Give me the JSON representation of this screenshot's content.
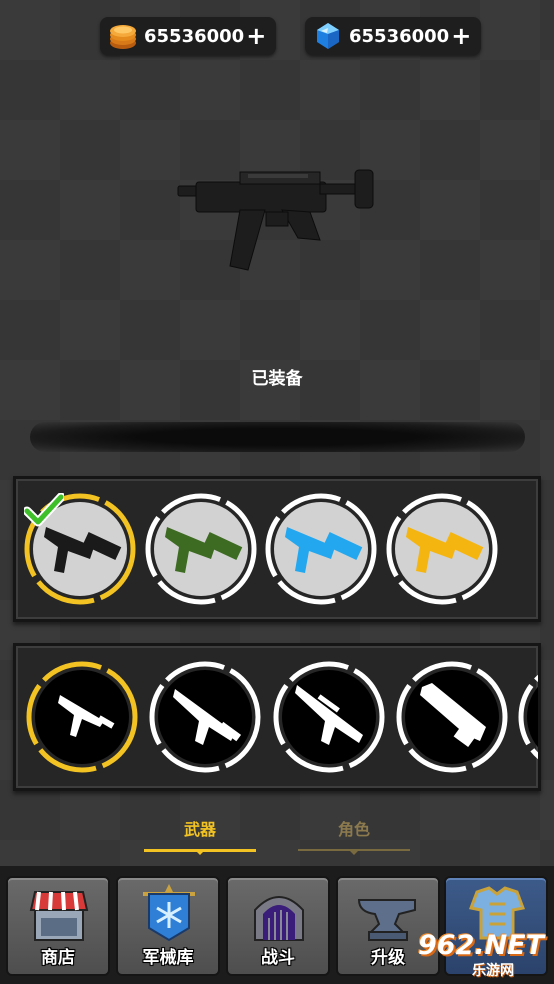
{
  "currency": {
    "coins": {
      "amount": "65536000",
      "plus": "+",
      "icon": "gold-coin-stack-icon",
      "color": "#e58a1c"
    },
    "gems": {
      "amount": "65536000",
      "plus": "+",
      "icon": "blue-gem-icon",
      "color": "#2fa0ff"
    }
  },
  "preview": {
    "status": "已装备",
    "weapon": "black-smg"
  },
  "skins": [
    {
      "name": "black",
      "color": "#1a1a1a",
      "selected": true,
      "equipped": true
    },
    {
      "name": "green",
      "color": "#3d6b22",
      "selected": false,
      "equipped": false
    },
    {
      "name": "blue",
      "color": "#23a8f0",
      "selected": false,
      "equipped": false
    },
    {
      "name": "yellow",
      "color": "#f5b511",
      "selected": false,
      "equipped": false
    }
  ],
  "weapons": [
    {
      "name": "smg",
      "selected": true
    },
    {
      "name": "assault-rifle",
      "selected": false
    },
    {
      "name": "rifle-scoped",
      "selected": false
    },
    {
      "name": "minigun",
      "selected": false
    },
    {
      "name": "locked-weapon",
      "selected": false
    }
  ],
  "tabs": {
    "weapons": "武器",
    "characters": "角色"
  },
  "nav": [
    {
      "label": "商店",
      "icon": "shop-icon"
    },
    {
      "label": "军械库",
      "icon": "armory-icon"
    },
    {
      "label": "战斗",
      "icon": "battle-gate-icon"
    },
    {
      "label": "升级",
      "icon": "anvil-icon"
    },
    {
      "label": "",
      "icon": "armor-icon"
    }
  ],
  "watermark": {
    "main": "962.NET",
    "sub": "乐游网"
  },
  "colors": {
    "accent": "#f2c322",
    "panel": "#262626"
  }
}
